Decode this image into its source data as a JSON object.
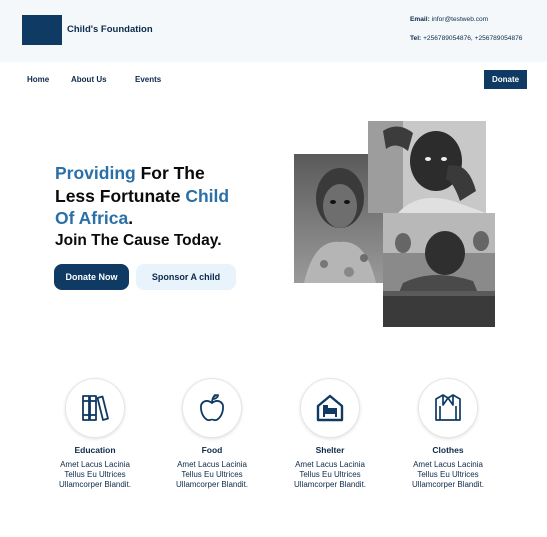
{
  "brand": {
    "name": "Child's Foundation"
  },
  "contact": {
    "email_label": "Email:",
    "email_value": "infor@testweb.com",
    "tel_label": "Tel:",
    "tel_value": "+256789054876, +256789054876"
  },
  "nav": {
    "home": "Home",
    "about": "About Us",
    "events": "Events",
    "donate": "Donate"
  },
  "hero": {
    "line1_accent": "Providing",
    "line1_rest": " For The",
    "line2_plain": "Less Fortunate ",
    "line2_accent": "Child",
    "line3_accent": "Of Africa",
    "line3_rest": ".",
    "line4": "Join The Cause Today.",
    "donate_now": "Donate Now",
    "sponsor": "Sponsor A child"
  },
  "features": [
    {
      "title": "Education",
      "desc_1": "Amet Lacus Lacinia",
      "desc_2": "Tellus Eu Ultrices",
      "desc_3": "Ullamcorper Blandit.",
      "icon": "books-icon"
    },
    {
      "title": "Food",
      "desc_1": "Amet Lacus Lacinia",
      "desc_2": "Tellus Eu Ultrices",
      "desc_3": "Ullamcorper Blandit.",
      "icon": "apple-icon"
    },
    {
      "title": "Shelter",
      "desc_1": "Amet Lacus Lacinia",
      "desc_2": "Tellus Eu Ultrices",
      "desc_3": "Ullamcorper Blandit.",
      "icon": "house-bed-icon"
    },
    {
      "title": "Clothes",
      "desc_1": "Amet Lacus Lacinia",
      "desc_2": "Tellus Eu Ultrices",
      "desc_3": "Ullamcorper Blandit.",
      "icon": "shirt-icon"
    }
  ],
  "colors": {
    "brand_navy": "#0f3a63",
    "accent_blue": "#2a6fa6",
    "topbar_bg": "#f4f8fb",
    "sponsor_bg": "#e9f3fb"
  }
}
